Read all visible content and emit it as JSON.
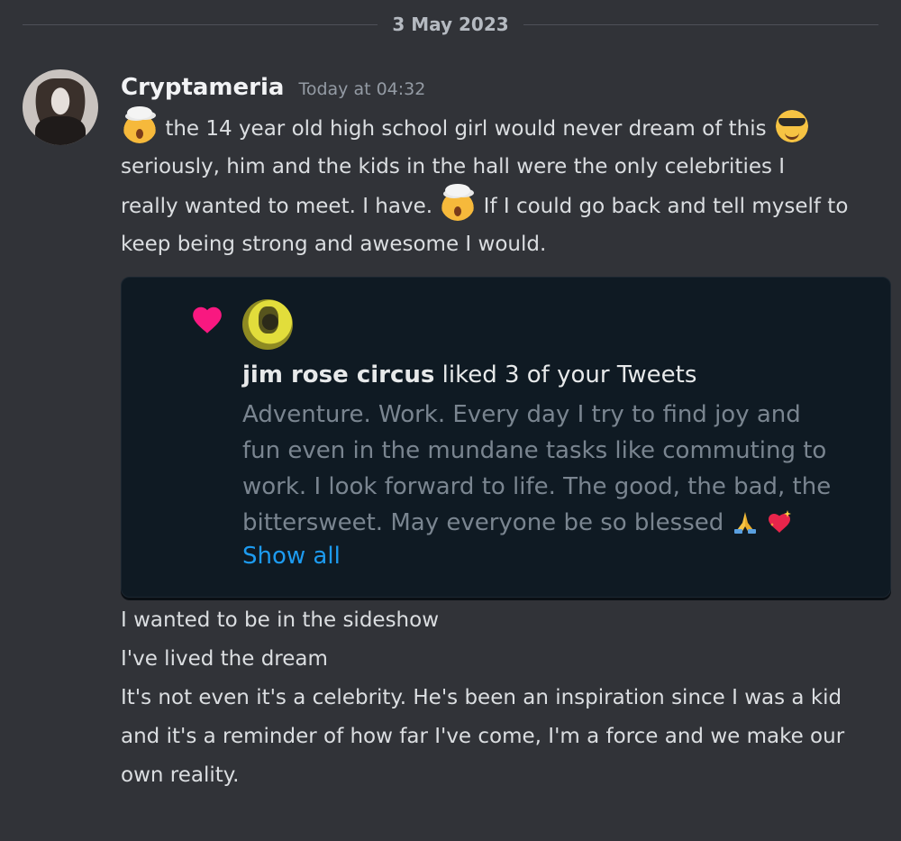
{
  "divider": {
    "date": "3 May 2023"
  },
  "message": {
    "username": "Cryptameria",
    "timestamp": "Today at 04:32",
    "line1": "the 14 year old high school girl would never dream of this",
    "line2": "seriously, him and the kids in the hall were the only celebrities I",
    "line3a": "really wanted to meet. I have.",
    "line3b": "If I could go back and tell myself to",
    "line4": "keep being strong and awesome I would."
  },
  "embed": {
    "liker_name": "jim rose circus",
    "liked_text": " liked 3 of your Tweets",
    "tweet_line1": "Adventure. Work. Every day I try to find joy and",
    "tweet_line2": "fun even in the mundane tasks like commuting to",
    "tweet_line3": "work. I look forward to life. The good, the bad, the",
    "tweet_line4": "bittersweet. May everyone be so blessed",
    "show_all": "Show all"
  },
  "followups": {
    "line1": "I wanted to be in the sideshow",
    "line2": "I've lived the dream",
    "line3": "It's not even it's a celebrity. He's been an inspiration since I was a kid",
    "line4": "and it's a reminder of how far I've come, I'm a force and we make our",
    "line5": "own reality."
  },
  "icons": {
    "avatar": "user-avatar",
    "emoji1": "exploding-head-emoji",
    "emoji2": "smiling-face-with-sunglasses-emoji",
    "emoji3": "exploding-head-emoji",
    "heart": "heart-icon",
    "pray": "folded-hands-emoji",
    "sparkle_heart": "sparkling-heart-emoji"
  },
  "colors": {
    "background": "#313338",
    "embed_background": "#0f1a23",
    "heart": "#f91880",
    "link": "#1d9bf0"
  }
}
